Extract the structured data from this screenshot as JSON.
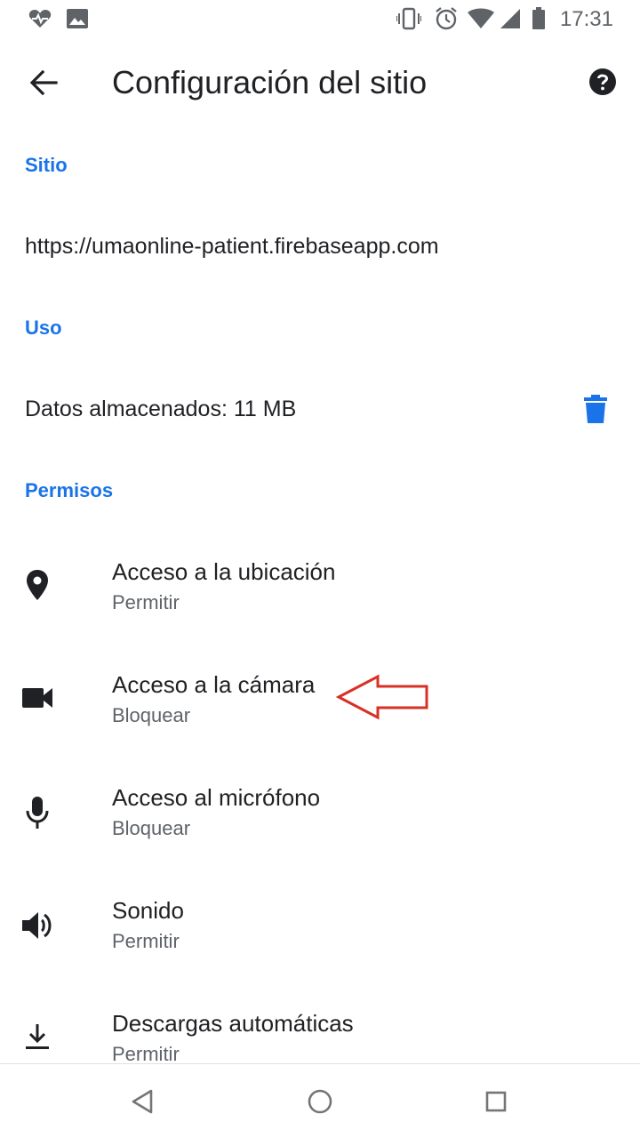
{
  "status_bar": {
    "time": "17:31",
    "left_icons": [
      "heart-monitor-icon",
      "image-icon"
    ],
    "right_icons": [
      "vibrate-icon",
      "alarm-icon",
      "wifi-icon",
      "signal-icon",
      "battery-icon"
    ]
  },
  "app_bar": {
    "title": "Configuración del sitio",
    "back_icon": "arrow-back-icon",
    "help_icon": "help-icon"
  },
  "sections": {
    "site": {
      "header": "Sitio",
      "url": "https://umaonline-patient.firebaseapp.com"
    },
    "usage": {
      "header": "Uso",
      "storage": "Datos almacenados: 11 MB",
      "delete_icon": "trash-icon"
    },
    "permissions": {
      "header": "Permisos",
      "items": [
        {
          "title": "Acceso a la ubicación",
          "value": "Permitir",
          "icon": "location-pin-icon"
        },
        {
          "title": "Acceso a la cámara",
          "value": "Bloquear",
          "icon": "camera-icon"
        },
        {
          "title": "Acceso al micrófono",
          "value": "Bloquear",
          "icon": "microphone-icon"
        },
        {
          "title": "Sonido",
          "value": "Permitir",
          "icon": "speaker-icon"
        },
        {
          "title": "Descargas automáticas",
          "value": "Permitir",
          "icon": "download-icon"
        }
      ]
    }
  },
  "annotation": {
    "icon": "red-arrow-icon",
    "color": "#d93025"
  },
  "nav_bar": {
    "icons": [
      "back-triangle-icon",
      "home-circle-icon",
      "recents-square-icon"
    ]
  },
  "colors": {
    "accent": "#1a73e8",
    "text": "#202124",
    "secondary": "#5f6368"
  }
}
